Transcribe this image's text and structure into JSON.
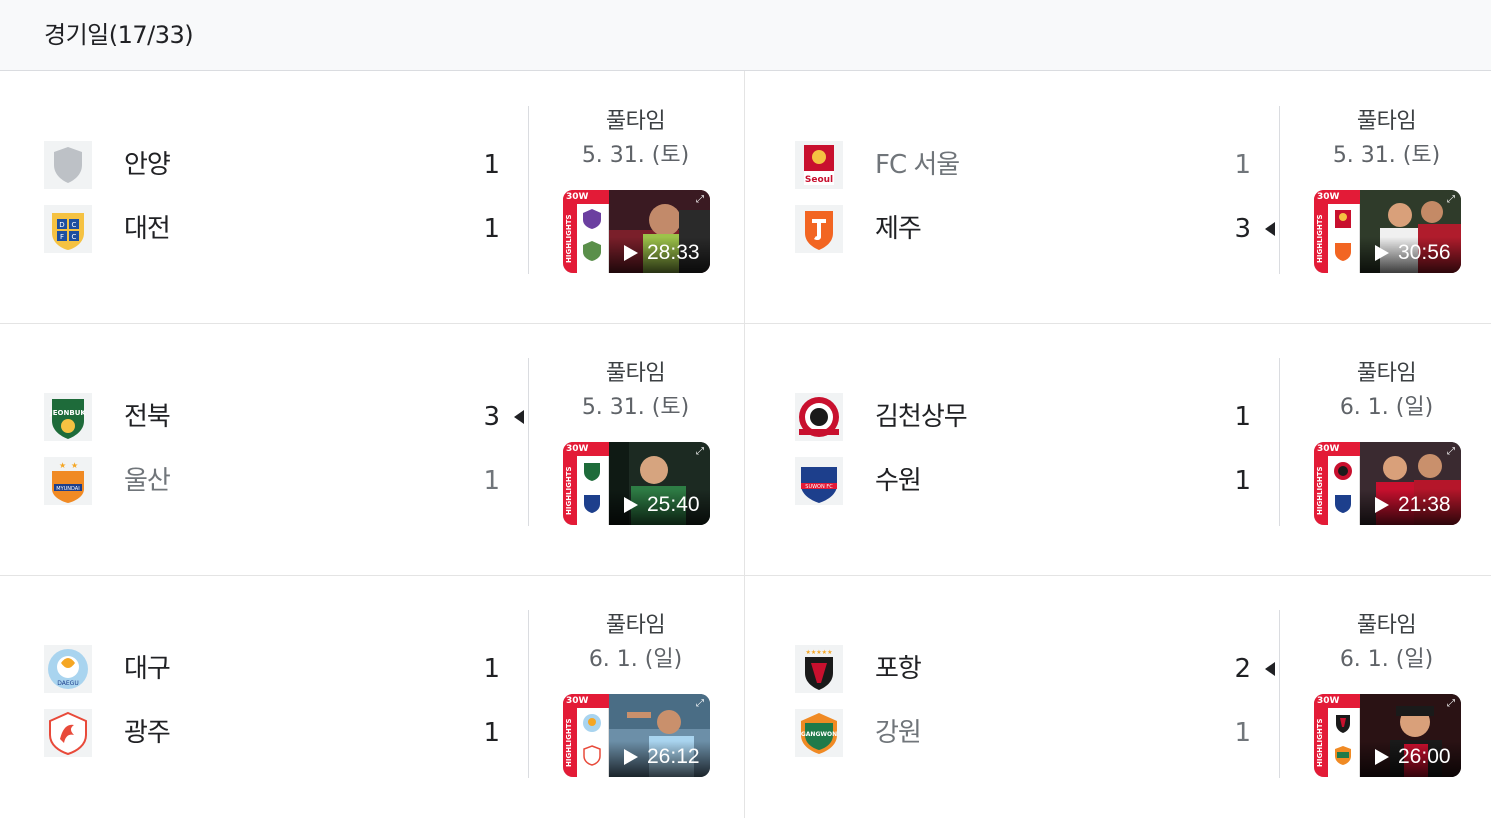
{
  "header": {
    "title": "경기일(17/33)"
  },
  "matches": [
    {
      "home": {
        "name": "안양",
        "score": "1",
        "logo": "shield-icon",
        "winner": false,
        "dim": false
      },
      "away": {
        "name": "대전",
        "score": "1",
        "logo": "daejeon-crest-icon",
        "winner": false,
        "dim": false
      },
      "status": "풀타임",
      "date": "5. 31. (토)",
      "duration": "28:33"
    },
    {
      "home": {
        "name": "FC 서울",
        "score": "1",
        "logo": "seoul-crest-icon",
        "winner": false,
        "dim": true
      },
      "away": {
        "name": "제주",
        "score": "3",
        "logo": "jeju-crest-icon",
        "winner": true,
        "dim": false
      },
      "status": "풀타임",
      "date": "5. 31. (토)",
      "duration": "30:56"
    },
    {
      "home": {
        "name": "전북",
        "score": "3",
        "logo": "jeonbuk-crest-icon",
        "winner": true,
        "dim": false
      },
      "away": {
        "name": "울산",
        "score": "1",
        "logo": "ulsan-crest-icon",
        "winner": false,
        "dim": true
      },
      "status": "풀타임",
      "date": "5. 31. (토)",
      "duration": "25:40"
    },
    {
      "home": {
        "name": "김천상무",
        "score": "1",
        "logo": "gimcheon-crest-icon",
        "winner": false,
        "dim": false
      },
      "away": {
        "name": "수원",
        "score": "1",
        "logo": "suwon-crest-icon",
        "winner": false,
        "dim": false
      },
      "status": "풀타임",
      "date": "6. 1. (일)",
      "duration": "21:38"
    },
    {
      "home": {
        "name": "대구",
        "score": "1",
        "logo": "daegu-crest-icon",
        "winner": false,
        "dim": false
      },
      "away": {
        "name": "광주",
        "score": "1",
        "logo": "gwangju-crest-icon",
        "winner": false,
        "dim": false
      },
      "status": "풀타임",
      "date": "6. 1. (일)",
      "duration": "26:12"
    },
    {
      "home": {
        "name": "포항",
        "score": "2",
        "logo": "pohang-crest-icon",
        "winner": true,
        "dim": false
      },
      "away": {
        "name": "강원",
        "score": "1",
        "logo": "gangwon-crest-icon",
        "winner": false,
        "dim": true
      },
      "status": "풀타임",
      "date": "6. 1. (일)",
      "duration": "26:00"
    }
  ],
  "thumbnail": {
    "tag": "30W",
    "vertical_label": "HIGHLIGHTS"
  },
  "colors": {
    "accent_red": "#e31b37",
    "text": "#202124",
    "muted": "#70757a"
  }
}
